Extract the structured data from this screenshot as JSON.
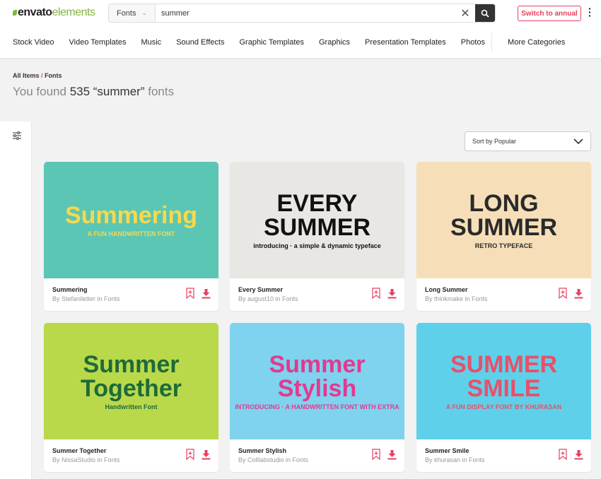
{
  "header": {
    "logo": {
      "bold": "envato",
      "light": "elements"
    },
    "search": {
      "category": "Fonts",
      "query": "summer"
    },
    "switch_label": "Switch to annual"
  },
  "nav": [
    "Stock Video",
    "Video Templates",
    "Music",
    "Sound Effects",
    "Graphic Templates",
    "Graphics",
    "Presentation Templates",
    "Photos",
    "More Categories"
  ],
  "breadcrumb": {
    "root": "All Items",
    "sep": "/",
    "current": "Fonts"
  },
  "results": {
    "prefix": "You found",
    "count": "535 “summer”",
    "suffix": "fonts"
  },
  "sort": {
    "selected": "Sort by Popular"
  },
  "accent": "#e6415f",
  "items": [
    {
      "title": "Summering",
      "author": "By Stefaniletter in Fonts",
      "thumb": {
        "line1": "Summering",
        "line2": "A FUN HANDWRITTEN FONT",
        "bg": "#5cc6b4",
        "fg": "#f7d94c"
      }
    },
    {
      "title": "Every Summer",
      "author": "By august10 in Fonts",
      "thumb": {
        "line1": "EVERY SUMMER",
        "line2": "introducing · a simple & dynamic typeface",
        "bg": "#e9e7e3",
        "fg": "#111111"
      }
    },
    {
      "title": "Long Summer",
      "author": "By thinkmake in Fonts",
      "thumb": {
        "line1": "LONG SUMMER",
        "line2": "RETRO TYPEFACE",
        "bg": "#f6dfb8",
        "fg": "#2a2a2a"
      }
    },
    {
      "title": "Summer Together",
      "author": "By NissaStudio in Fonts",
      "thumb": {
        "line1": "Summer Together",
        "line2": "Handwritten Font",
        "bg": "#b9d94a",
        "fg": "#1e6a3a"
      }
    },
    {
      "title": "Summer Stylish",
      "author": "By Colllabstudio in Fonts",
      "thumb": {
        "line1": "Summer Stylish",
        "line2": "INTRODUCING · A HANDWRITTEN FONT WITH EXTRA",
        "bg": "#7fd3ee",
        "fg": "#e3398f"
      }
    },
    {
      "title": "Summer Smile",
      "author": "By khurasan in Fonts",
      "thumb": {
        "line1": "SUMMER SMILE",
        "line2": "A FUN DISPLAY FONT BY KHURASAN",
        "bg": "#5fd0ea",
        "fg": "#e8506a"
      }
    }
  ]
}
